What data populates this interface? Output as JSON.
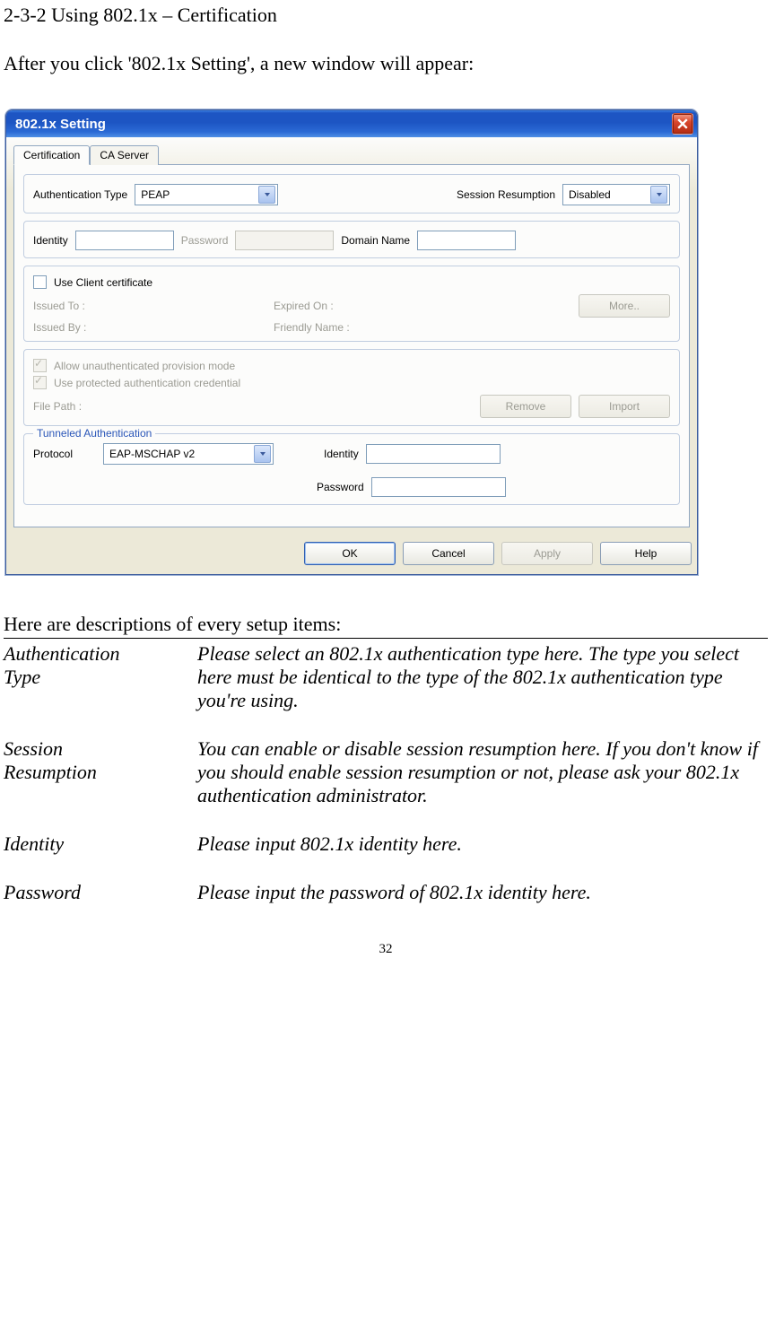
{
  "section_heading": "2-3-2 Using 802.1x – Certification",
  "intro_text": "After you click '802.1x Setting', a new window will appear:",
  "dialog": {
    "title": "802.1x Setting",
    "tabs": {
      "cert": "Certification",
      "ca": "CA Server"
    },
    "auth_type_label": "Authentication Type",
    "auth_type_value": "PEAP",
    "session_res_label": "Session Resumption",
    "session_res_value": "Disabled",
    "identity_label": "Identity",
    "identity_value": "",
    "password_label": "Password",
    "password_value": "",
    "domain_label": "Domain Name",
    "domain_value": "",
    "use_client_cert": "Use Client certificate",
    "issued_to": "Issued To :",
    "expired_on": "Expired On :",
    "issued_by": "Issued By :",
    "friendly_name": "Friendly Name :",
    "more_btn": "More..",
    "allow_unauth": "Allow unauthenticated provision mode",
    "use_protected": "Use protected authentication credential",
    "file_path_label": "File Path :",
    "remove_btn": "Remove",
    "import_btn": "Import",
    "tunneled_legend": "Tunneled Authentication",
    "tun_protocol_label": "Protocol",
    "tun_protocol_value": "EAP-MSCHAP v2",
    "tun_identity_label": "Identity",
    "tun_identity_value": "",
    "tun_password_label": "Password",
    "tun_password_value": "",
    "ok": "OK",
    "cancel": "Cancel",
    "apply": "Apply",
    "help": "Help"
  },
  "desc_intro": "Here are descriptions of every setup items:",
  "descriptions": {
    "auth": {
      "term": "Authentication\nType",
      "text": "Please select an 802.1x authentication type here. The type you select here must be identical to the type of the 802.1x authentication type you're using."
    },
    "session": {
      "term": "Session\nResumption",
      "text": "You can enable or disable session resumption here. If you don't know if you should enable session resumption or not, please ask your 802.1x authentication administrator."
    },
    "identity": {
      "term": "Identity",
      "text": "Please input 802.1x identity here."
    },
    "password": {
      "term": "Password",
      "text": "Please input the password of 802.1x identity here."
    }
  },
  "page_number": "32"
}
